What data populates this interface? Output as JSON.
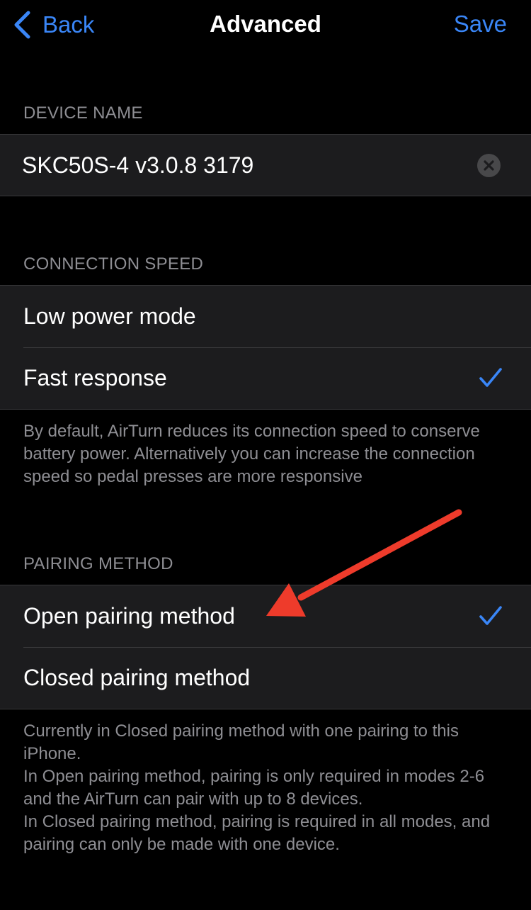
{
  "nav": {
    "back_label": "Back",
    "title": "Advanced",
    "save_label": "Save"
  },
  "device_name": {
    "header": "DEVICE NAME",
    "value": "SKC50S-4 v3.0.8 3179"
  },
  "connection_speed": {
    "header": "CONNECTION SPEED",
    "options": [
      {
        "label": "Low power mode",
        "selected": false
      },
      {
        "label": "Fast response",
        "selected": true
      }
    ],
    "footer": "By default, AirTurn reduces its connection speed to conserve battery power. Alternatively you can increase the connection speed so pedal presses are more responsive"
  },
  "pairing_method": {
    "header": "PAIRING METHOD",
    "options": [
      {
        "label": "Open pairing method",
        "selected": true
      },
      {
        "label": "Closed pairing method",
        "selected": false
      }
    ],
    "footer_lines": [
      "Currently in Closed pairing method with one pairing to this iPhone.",
      "In Open pairing method, pairing is only required in modes 2-6 and the AirTurn can pair with up to 8 devices.",
      "In Closed pairing method, pairing is required in all modes, and pairing can only be made with one device."
    ]
  },
  "colors": {
    "background": "#000000",
    "cell": "#1c1c1e",
    "accent": "#3a86f7",
    "secondary_text": "#8e8e93",
    "annotation_arrow": "#ee3b2b"
  },
  "icons": {
    "back": "chevron-left-icon",
    "clear": "clear-circle-icon",
    "check": "checkmark-icon",
    "annotation": "red-arrow-icon"
  }
}
